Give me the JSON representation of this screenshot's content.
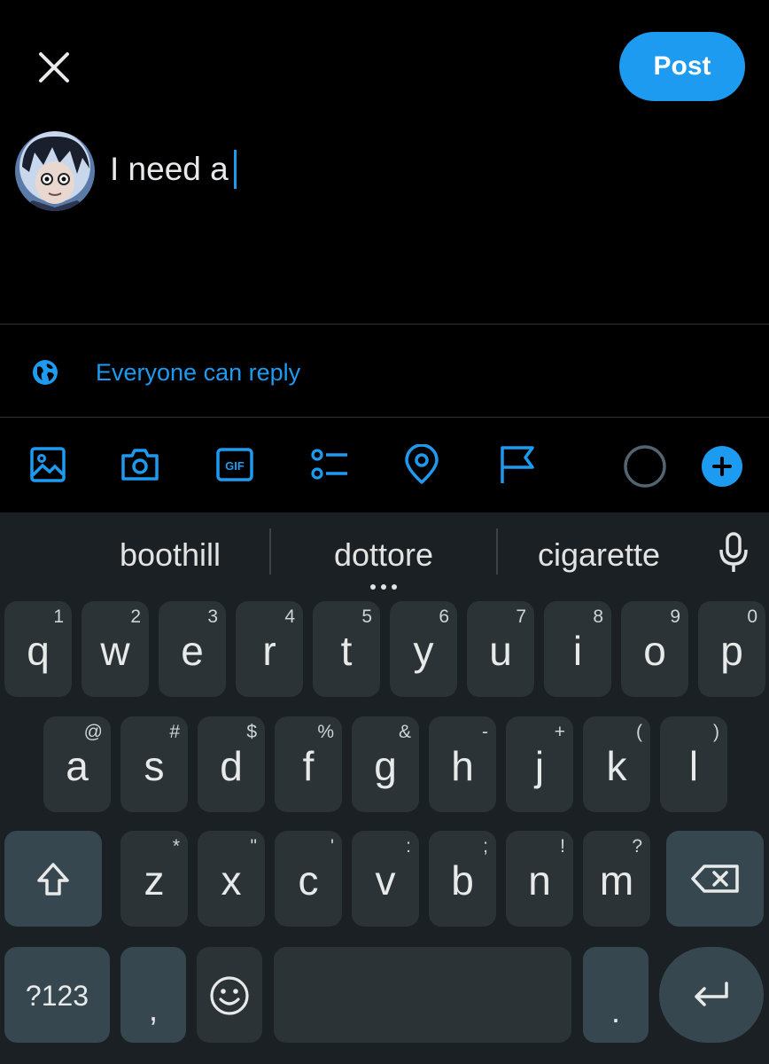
{
  "composer": {
    "post_label": "Post",
    "draft_text": "I need a",
    "reply_setting": "Everyone can reply"
  },
  "toolbar_icons": [
    "image-icon",
    "camera-icon",
    "gif-icon",
    "poll-icon",
    "location-icon",
    "flag-icon",
    "character-count-ring-icon",
    "add-thread-icon"
  ],
  "toolbar": {
    "gif_label": "GIF"
  },
  "keyboard": {
    "suggestions": [
      "boothill",
      "dottore",
      "cigarette"
    ],
    "row1": [
      {
        "k": "q",
        "h": "1"
      },
      {
        "k": "w",
        "h": "2"
      },
      {
        "k": "e",
        "h": "3"
      },
      {
        "k": "r",
        "h": "4"
      },
      {
        "k": "t",
        "h": "5"
      },
      {
        "k": "y",
        "h": "6"
      },
      {
        "k": "u",
        "h": "7"
      },
      {
        "k": "i",
        "h": "8"
      },
      {
        "k": "o",
        "h": "9"
      },
      {
        "k": "p",
        "h": "0"
      }
    ],
    "row2": [
      {
        "k": "a",
        "h": "@"
      },
      {
        "k": "s",
        "h": "#"
      },
      {
        "k": "d",
        "h": "$"
      },
      {
        "k": "f",
        "h": "%"
      },
      {
        "k": "g",
        "h": "&"
      },
      {
        "k": "h",
        "h": "-"
      },
      {
        "k": "j",
        "h": "+"
      },
      {
        "k": "k",
        "h": "("
      },
      {
        "k": "l",
        "h": ")"
      }
    ],
    "row3": [
      {
        "k": "z",
        "h": "*"
      },
      {
        "k": "x",
        "h": "\""
      },
      {
        "k": "c",
        "h": "'"
      },
      {
        "k": "v",
        "h": ":"
      },
      {
        "k": "b",
        "h": ";"
      },
      {
        "k": "n",
        "h": "!"
      },
      {
        "k": "m",
        "h": "?"
      }
    ],
    "symbols_label": "?123",
    "comma_label": ",",
    "period_label": "."
  },
  "colors": {
    "accent": "#1d9bf0",
    "keyboard_bg": "#1a2024",
    "key_bg": "#2c3336",
    "key_dark": "#37474f"
  }
}
